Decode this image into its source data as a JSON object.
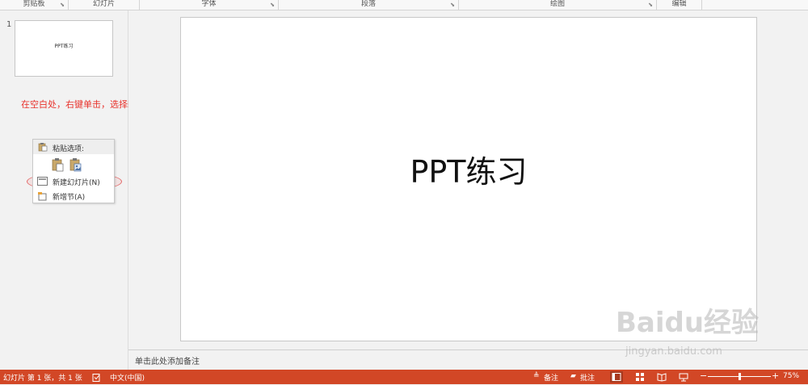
{
  "ribbon": {
    "groups": [
      {
        "label": "剪贴板",
        "launcher": true
      },
      {
        "label": "幻灯片",
        "launcher": false
      },
      {
        "label": "字体",
        "launcher": true
      },
      {
        "label": "段落",
        "launcher": true
      },
      {
        "label": "绘图",
        "launcher": true
      },
      {
        "label": "编辑",
        "launcher": false
      }
    ]
  },
  "thumbnails": {
    "slide_number": "1",
    "slide_title": "PPT练习"
  },
  "annotation": "在空白处，右键单击，选择新建幻灯片",
  "context_menu": {
    "header": "粘贴选项:",
    "items": [
      {
        "label": "新建幻灯片(N)",
        "icon": "new-slide-icon"
      },
      {
        "label": "新增节(A)",
        "icon": "new-section-icon"
      }
    ]
  },
  "slide": {
    "title": "PPT练习"
  },
  "notes": {
    "placeholder": "单击此处添加备注"
  },
  "status_bar": {
    "slide_info": "幻灯片 第 1 张，共 1 张",
    "language": "中文(中国)",
    "notes_label": "备注",
    "comments_label": "批注",
    "zoom": "75%",
    "zoom_fraction": 0.5
  },
  "watermark": {
    "text": "Baidu经验",
    "sub": "jingyan.baidu.com"
  },
  "colors": {
    "status_bar": "#d24726",
    "annotation": "#e8322b"
  }
}
